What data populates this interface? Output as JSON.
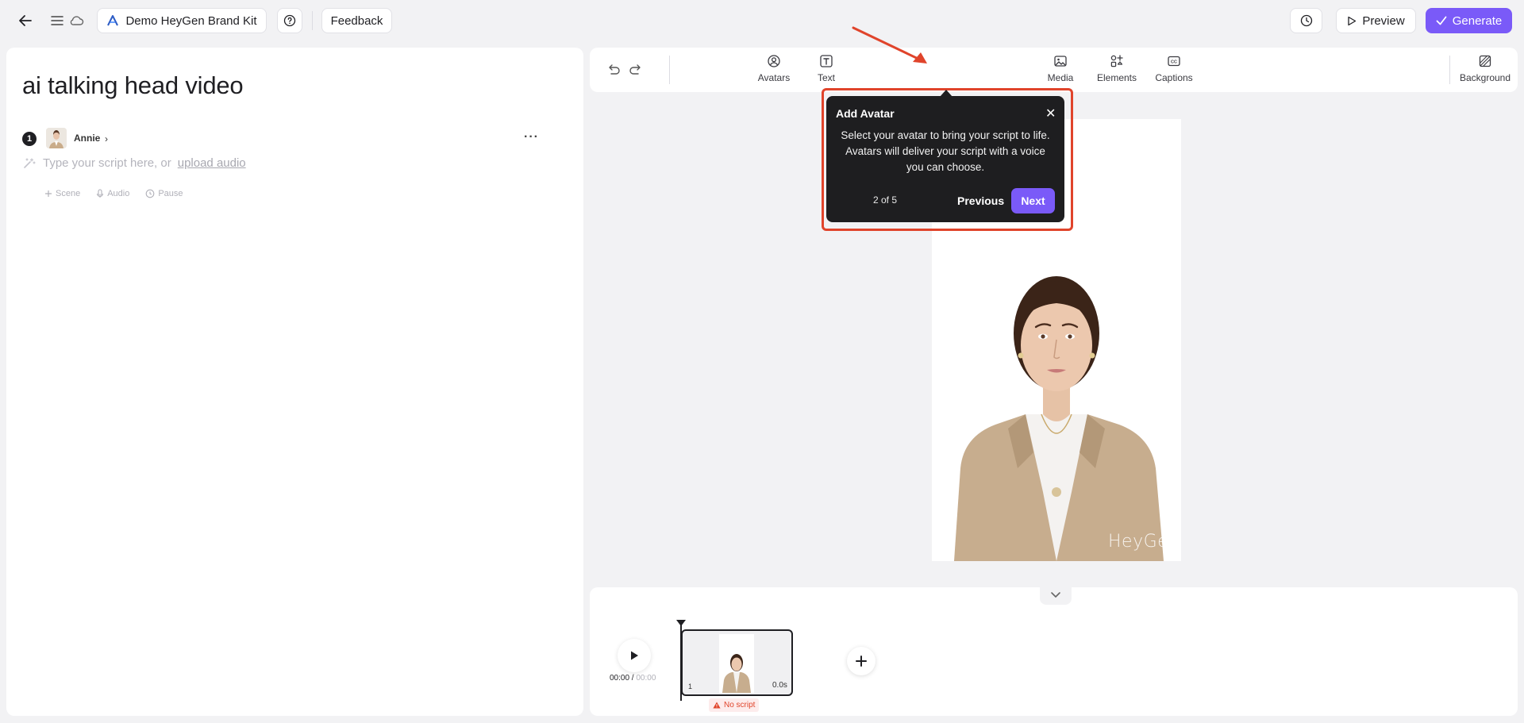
{
  "topbar": {
    "brand_kit_label": "Demo HeyGen Brand Kit",
    "feedback_label": "Feedback",
    "preview_label": "Preview",
    "generate_label": "Generate",
    "accent_color": "#7a5af8"
  },
  "script_panel": {
    "title": "ai talking head video",
    "scene_number": "1",
    "avatar_name": "Annie",
    "script_placeholder": "Type your script here, or",
    "upload_audio_link": "upload audio",
    "actions": {
      "scene": "Scene",
      "audio": "Audio",
      "pause": "Pause"
    }
  },
  "toolbar": {
    "avatars": "Avatars",
    "text": "Text",
    "media": "Media",
    "elements": "Elements",
    "captions": "Captions",
    "background": "Background"
  },
  "canvas": {
    "watermark": "HeyGen"
  },
  "tour": {
    "title": "Add Avatar",
    "body": "Select your avatar to bring your script to life. Avatars will deliver your script with a voice you can choose.",
    "step": "2 of 5",
    "previous_label": "Previous",
    "next_label": "Next",
    "highlight_color": "#e0442b"
  },
  "timeline": {
    "current_time": "00:00",
    "separator": " / ",
    "total_time": "00:00",
    "clip_number": "1",
    "clip_duration": "0.0s",
    "warning": "No script"
  }
}
